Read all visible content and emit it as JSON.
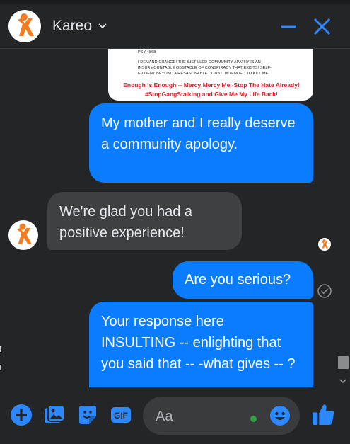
{
  "header": {
    "contact_name": "Kareo"
  },
  "messages": {
    "image_text": {
      "line0": "PSY-4868",
      "line1": "I DEMAND CHANGE! THE INSTILLED COMMUNITY APATHY IS AN",
      "line2": "INSURMOUNTABLE OBSTACLE OF CONSPIRACY THAT EXISTS! SELF-",
      "line3": "EVIDENT BEYOND A RESASONABLE DOUBT! INTENDED TO KILL ME!",
      "red1": "Enough Is Enough -- Mercy Mercy Me -Stop The Hate Already!",
      "red2": "#StopGangStalking and Give Me My Life Back!"
    },
    "m1": "My mother and I really deserve a community apology.",
    "m2": "We're glad you had a positive experience!",
    "m3": "Are you serious?",
    "m4": "Your response here INSULTING -- enlighting that you said that -- -what gives -- ?"
  },
  "composer": {
    "placeholder": "Aa"
  },
  "colors": {
    "brand_orange": "#f47b20",
    "messenger_blue": "#0a7cff",
    "online_green": "#31a24c"
  },
  "icons": [
    "kareo-logo",
    "chevron-down-icon",
    "minimize-icon",
    "close-icon",
    "add-icon",
    "photo-icon",
    "sticker-icon",
    "gif-icon",
    "emoji-icon",
    "thumbs-up-icon",
    "sent-check-icon"
  ]
}
